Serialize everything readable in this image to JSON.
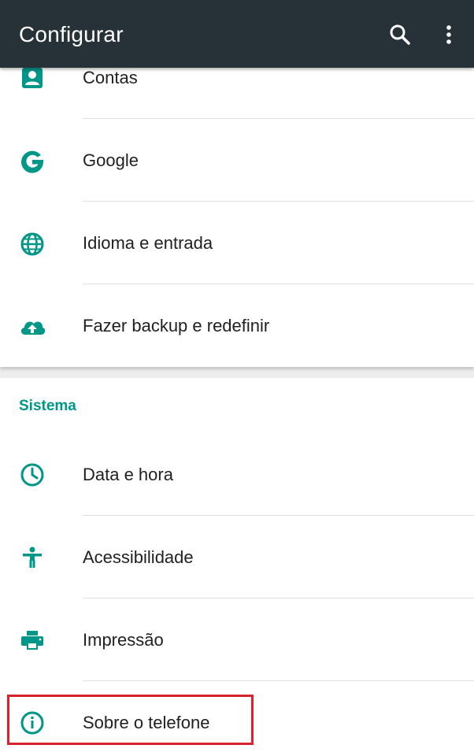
{
  "appbar": {
    "title": "Configurar",
    "search_icon": "search-icon",
    "more_icon": "more-vert-icon",
    "background_color": "#263238"
  },
  "accent_color": "#009688",
  "personal_items": [
    {
      "label": "Contas",
      "icon": "account-box-icon"
    },
    {
      "label": "Google",
      "icon": "google-g-icon"
    },
    {
      "label": "Idioma e entrada",
      "icon": "globe-icon"
    },
    {
      "label": "Fazer backup e redefinir",
      "icon": "cloud-upload-icon"
    }
  ],
  "system_section": {
    "header": "Sistema",
    "items": [
      {
        "label": "Data e hora",
        "icon": "clock-icon"
      },
      {
        "label": "Acessibilidade",
        "icon": "accessibility-icon"
      },
      {
        "label": "Impressão",
        "icon": "print-icon"
      },
      {
        "label": "Sobre o telefone",
        "icon": "info-icon"
      }
    ]
  },
  "highlight_color": "#d7232e"
}
